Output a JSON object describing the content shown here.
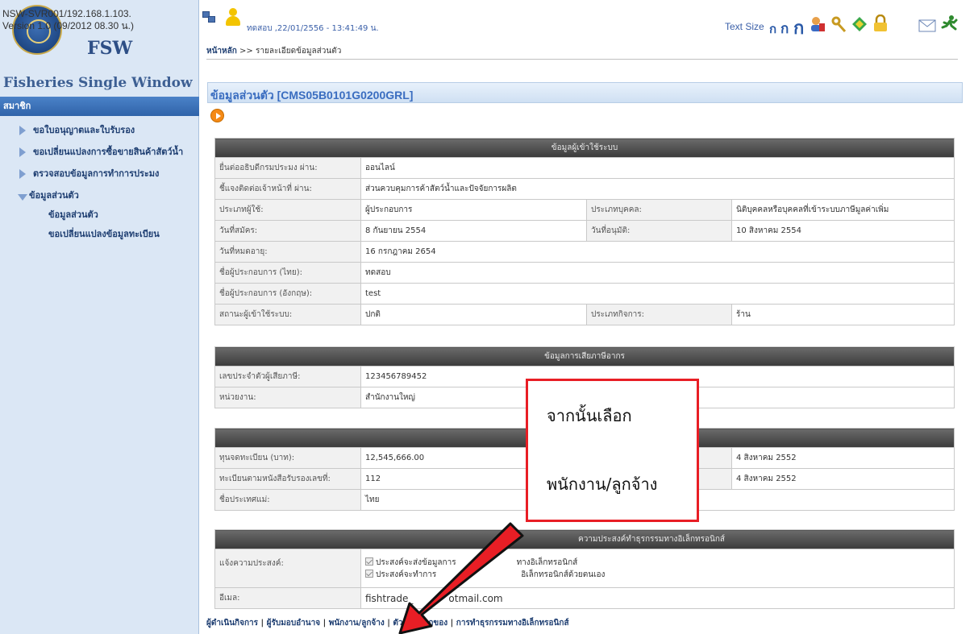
{
  "sidebar": {
    "server_line": "NSW-SVR001/192.168.1.103.",
    "version_line": "Version 1.0 (09/2012 08.30 น.)",
    "logo_short": "FSW",
    "brand": "Fisheries Single Window",
    "section": "สมาชิก",
    "items": [
      {
        "label": "ขอใบอนุญาตและใบรับรอง"
      },
      {
        "label": "ขอเปลี่ยนแปลงการซื้อขายสินค้าสัตว์น้ำ"
      },
      {
        "label": "ตรวจสอบข้อมูลการทำการประมง"
      },
      {
        "label": "ข้อมูลส่วนตัว"
      }
    ],
    "subitems": [
      {
        "label": "ข้อมูลส่วนตัว"
      },
      {
        "label": "ขอเปลี่ยนแปลงข้อมูลทะเบียน"
      }
    ]
  },
  "header": {
    "user_line": "ทดสอบ ,22/01/2556 - 13:41:49 น.",
    "text_size_label": "Text Size",
    "text_size_small": "ก",
    "text_size_medium": "ก",
    "text_size_large": "ก"
  },
  "breadcrumb": {
    "home": "หน้าหลัก",
    "sep": ">>",
    "current": "รายละเอียดข้อมูลส่วนตัว"
  },
  "page_title": "ข้อมูลส่วนตัว [CMS05B0101G0200GRL]",
  "user_info": {
    "heading": "ข้อมูลผู้เข้าใช้ระบบ",
    "rows": [
      {
        "label": "ยื่นต่ออธิบดีกรมประมง ผ่าน:",
        "value": "ออนไลน์"
      },
      {
        "label": "ชี้แจงติดต่อเจ้าหน้าที่ ผ่าน:",
        "value": "ส่วนควบคุมการค้าสัตว์น้ำและปัจจัยการผลิต"
      },
      {
        "label": "ประเภทผู้ใช้:",
        "value": "ผู้ประกอบการ",
        "label2": "ประเภทบุคคล:",
        "value2": "นิติบุคคลหรือบุคคลที่เข้าระบบภาษีมูลค่าเพิ่ม"
      },
      {
        "label": "วันที่สมัคร:",
        "value": "8 กันยายน 2554",
        "label2": "วันที่อนุมัติ:",
        "value2": "10 สิงหาคม 2554"
      },
      {
        "label": "วันที่หมดอายุ:",
        "value": "16 กรกฎาคม 2654"
      },
      {
        "label": "ชื่อผู้ประกอบการ (ไทย):",
        "value": "ทดสอบ"
      },
      {
        "label": "ชื่อผู้ประกอบการ (อังกฤษ):",
        "value": "test"
      },
      {
        "label": "สถานะผู้เข้าใช้ระบบ:",
        "value": "ปกติ",
        "label2": "ประเภทกิจการ:",
        "value2": "ร้าน"
      }
    ]
  },
  "tax_info": {
    "heading": "ข้อมูลการเสียภาษีอากร",
    "rows": [
      {
        "label": "เลขประจำตัวผู้เสียภาษี:",
        "value": "123456789452"
      },
      {
        "label": "หน่วยงาน:",
        "value": "สำนักงานใหญ่"
      }
    ]
  },
  "registration_info": {
    "rows": [
      {
        "label": "ทุนจดทะเบียน (บาท):",
        "value": "12,545,666.00",
        "value2": "4 สิงหาคม 2552"
      },
      {
        "label": "ทะเบียนตามหนังสือรับรองเลขที่:",
        "value": "112",
        "value2": "4 สิงหาคม 2552"
      },
      {
        "label": "ชื่อประเทศแม่:",
        "value": "ไทย"
      }
    ]
  },
  "ecommerce_info": {
    "heading": "ความประสงค์ทำธุรกรรมทางอิเล็กทรอนิกส์",
    "intent_label": "แจ้งความประสงค์:",
    "option1_a": "ประสงค์จะส่งข้อมูลการ",
    "option1_b": "ทางอิเล็กทรอนิกส์",
    "option2_a": "ประสงค์จะทำการ",
    "option2_b": "อิเล็กทรอนิกส์ด้วยตนเอง",
    "email_label": "อีเมล:",
    "email_a": "fishtrade_",
    "email_b": "otmail.com"
  },
  "bottom_links": [
    {
      "label": "ผู้ดำเนินกิจการ"
    },
    {
      "label": "ผู้รับมอบอำนาจ"
    },
    {
      "label": "พนักงาน/ลูกจ้าง"
    },
    {
      "label": "ตัวแทนออกของ"
    },
    {
      "label": "การทำธุรกรรมทางอิเล็กทรอนิกส์"
    }
  ],
  "callout": {
    "line1": "จากนั้นเลือก",
    "line2": "พนักงาน/ลูกจ้าง"
  },
  "colors": {
    "sidebar_bg": "#dbe7f5",
    "accent_blue": "#3a6dc0",
    "table_header": "#4a4a4a",
    "annotation_red": "#e81e25"
  }
}
